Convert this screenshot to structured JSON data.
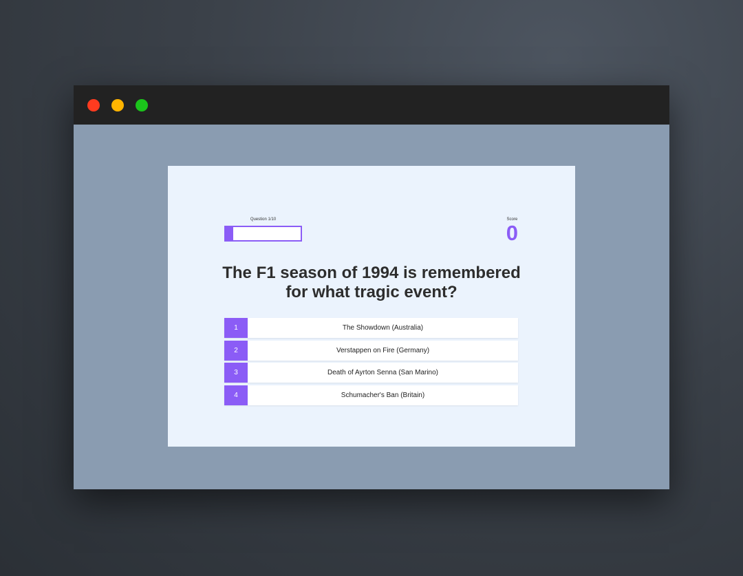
{
  "window": {
    "traffic_lights": {
      "close_color": "#ff3b1f",
      "minimize_color": "#ffb400",
      "maximize_color": "#1bc41b"
    }
  },
  "quiz": {
    "progress": {
      "label": "Question 1/10",
      "current": 1,
      "total": 10,
      "fraction": 0.1
    },
    "score": {
      "label": "Score",
      "value": "0"
    },
    "question": "The F1 season of 1994 is remembered for what tragic event?",
    "answers": [
      {
        "number": "1",
        "text": "The Showdown (Australia)"
      },
      {
        "number": "2",
        "text": "Verstappen on Fire (Germany)"
      },
      {
        "number": "3",
        "text": "Death of Ayrton Senna (San Marino)"
      },
      {
        "number": "4",
        "text": "Schumacher's Ban (Britain)"
      }
    ],
    "accent_color": "#8b5cf6"
  }
}
